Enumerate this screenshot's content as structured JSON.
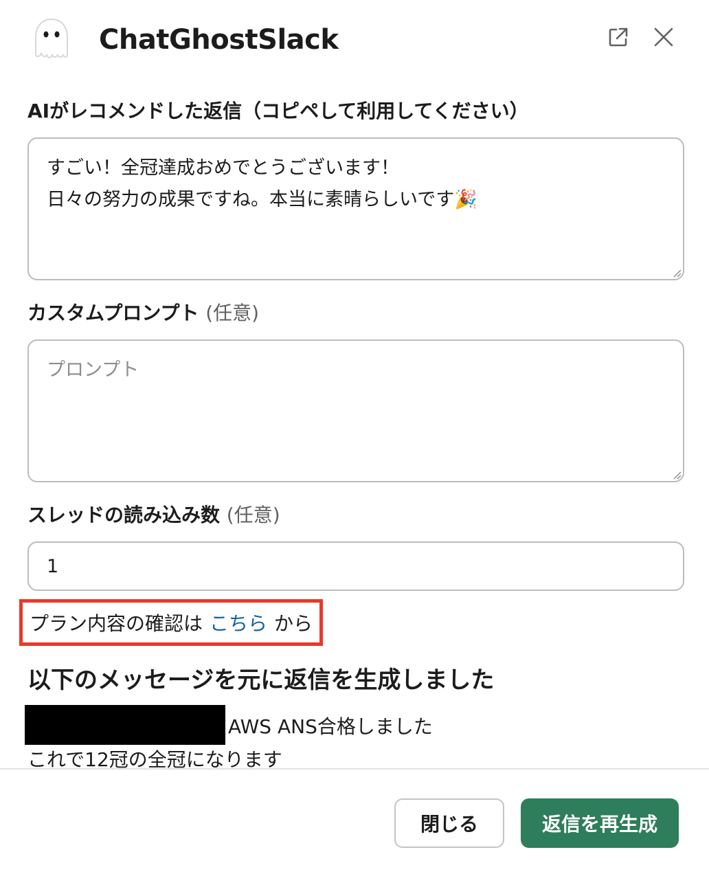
{
  "app": {
    "title": "ChatGhostSlack"
  },
  "header": {
    "external_icon": "external-link-icon",
    "close_icon": "close-icon"
  },
  "recommended_reply": {
    "label": "AIがレコメンドした返信（コピペして利用してください）",
    "value": "すごい！全冠達成おめでとうございます！\n日々の努力の成果ですね。本当に素晴らしいです🎉"
  },
  "custom_prompt": {
    "label": "カスタムプロンプト",
    "optional": "(任意)",
    "placeholder": "プロンプト",
    "value": ""
  },
  "thread_count": {
    "label": "スレッドの読み込み数",
    "optional": "(任意)",
    "value": "1"
  },
  "plan": {
    "prefix": "プラン内容の確認は",
    "link": "こちら",
    "suffix": "から"
  },
  "source_message": {
    "heading": "以下のメッセージを元に返信を生成しました",
    "line1": "AWS ANS合格しました",
    "line2": "これで12冠の全冠になります"
  },
  "footer": {
    "close_label": "閉じる",
    "regenerate_label": "返信を再生成"
  },
  "colors": {
    "primary_button": "#2e7d5b",
    "link": "#1264a3",
    "highlight_border": "#e8392b"
  }
}
